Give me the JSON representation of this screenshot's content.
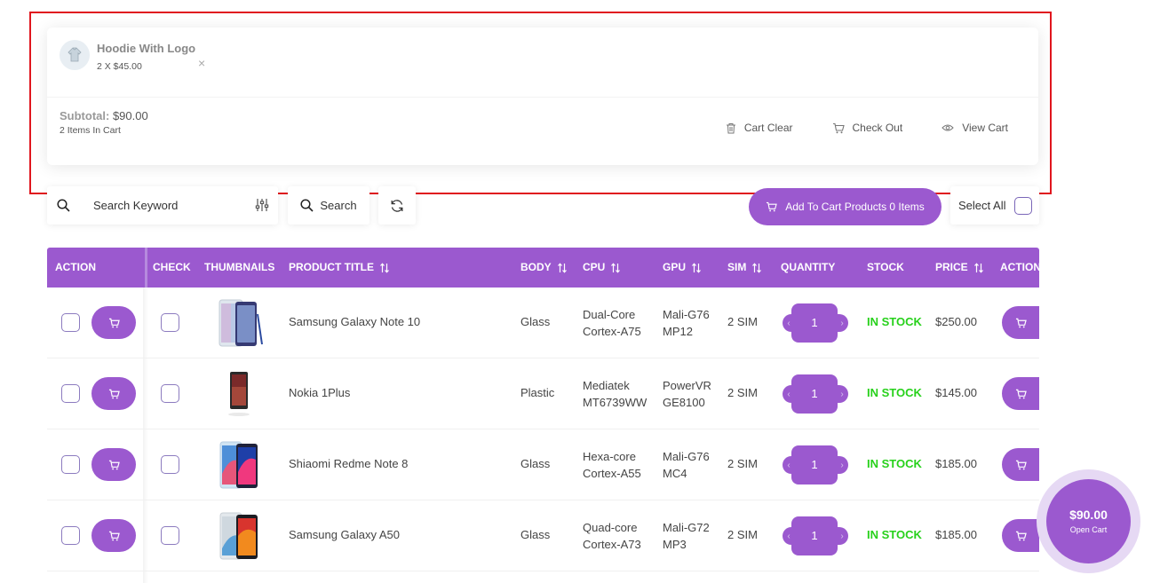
{
  "mini_cart": {
    "item": {
      "name": "Hoodie With Logo",
      "qty_price": "2 X $45.00",
      "remove_symbol": "×"
    },
    "subtotal_label": "Subtotal:",
    "subtotal_value": "$90.00",
    "count": "2 Items In Cart",
    "actions": {
      "clear": "Cart Clear",
      "checkout": "Check Out",
      "view": "View Cart"
    }
  },
  "toolbar": {
    "search_placeholder": "Search Keyword",
    "search_button": "Search",
    "add_to_cart_button": "Add To Cart Products 0 Items",
    "select_all": "Select All"
  },
  "table": {
    "headers": {
      "action": "Action",
      "check": "Check",
      "thumbnails": "Thumbnails",
      "product_title": "Product Title",
      "body": "Body",
      "cpu": "CPU",
      "gpu": "GPU",
      "sim": "SIM",
      "quantity": "Quantity",
      "stock": "Stock",
      "price": "Price",
      "action2": "Action"
    },
    "rows": [
      {
        "title": "Samsung Galaxy Note 10",
        "body": "Glass",
        "cpu1": "Dual-Core",
        "cpu2": "Cortex-A75",
        "gpu1": "Mali-G76",
        "gpu2": "MP12",
        "sim": "2 SIM",
        "qty": "1",
        "stock": "IN STOCK",
        "price": "$250.00"
      },
      {
        "title": "Nokia 1Plus",
        "body": "Plastic",
        "cpu1": "Mediatek",
        "cpu2": "MT6739WW",
        "gpu1": "PowerVR",
        "gpu2": "GE8100",
        "sim": "2 SIM",
        "qty": "1",
        "stock": "IN STOCK",
        "price": "$145.00"
      },
      {
        "title": "Shiaomi Redme Note 8",
        "body": "Glass",
        "cpu1": "Hexa-core",
        "cpu2": "Cortex-A55",
        "gpu1": "Mali-G76",
        "gpu2": "MC4",
        "sim": "2 SIM",
        "qty": "1",
        "stock": "IN STOCK",
        "price": "$185.00"
      },
      {
        "title": "Samsung Galaxy A50",
        "body": "Glass",
        "cpu1": "Quad-core",
        "cpu2": "Cortex-A73",
        "gpu1": "Mali-G72",
        "gpu2": "MP3",
        "sim": "2 SIM",
        "qty": "1",
        "stock": "IN STOCK",
        "price": "$185.00"
      }
    ]
  },
  "float_cart": {
    "amount": "$90.00",
    "label": "Open Cart"
  },
  "colors": {
    "accent": "#9b59cf",
    "stock": "#27d11b",
    "highlight": "#e0161e"
  }
}
